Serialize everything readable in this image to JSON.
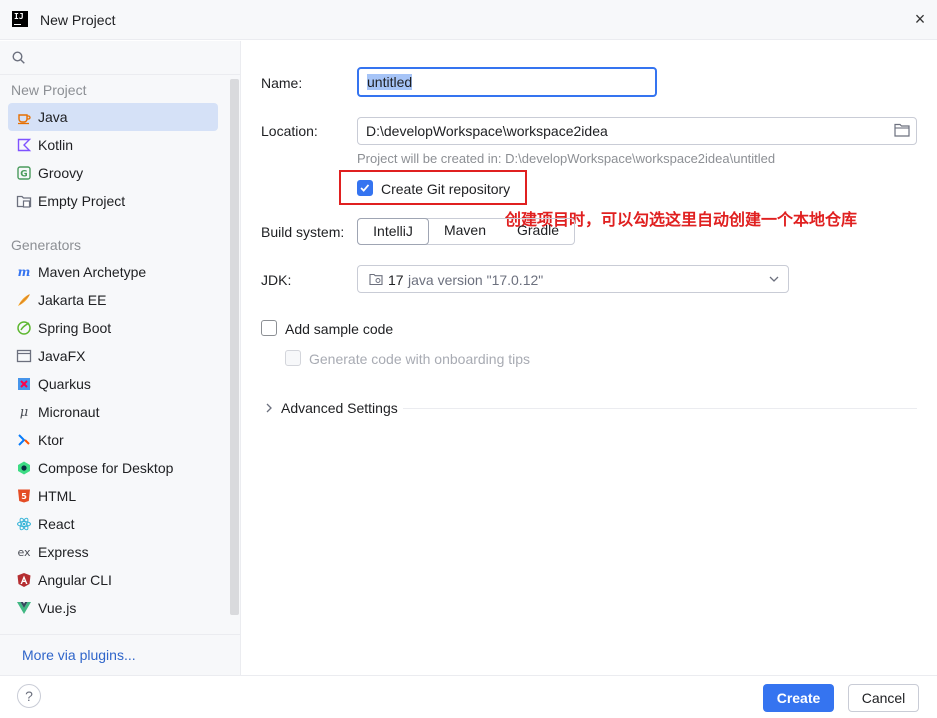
{
  "window": {
    "title": "New Project",
    "close_glyph": "×"
  },
  "sidebar": {
    "search_placeholder": "",
    "group_new_project": "New Project",
    "group_generators": "Generators",
    "new_project_items": [
      {
        "label": "Java",
        "icon": "java-icon",
        "selected": true
      },
      {
        "label": "Kotlin",
        "icon": "kotlin-icon"
      },
      {
        "label": "Groovy",
        "icon": "groovy-icon"
      },
      {
        "label": "Empty Project",
        "icon": "empty-project-icon"
      }
    ],
    "generator_items": [
      {
        "label": "Maven Archetype",
        "icon": "maven-icon"
      },
      {
        "label": "Jakarta EE",
        "icon": "jakarta-icon"
      },
      {
        "label": "Spring Boot",
        "icon": "spring-icon"
      },
      {
        "label": "JavaFX",
        "icon": "javafx-icon"
      },
      {
        "label": "Quarkus",
        "icon": "quarkus-icon"
      },
      {
        "label": "Micronaut",
        "icon": "micronaut-icon"
      },
      {
        "label": "Ktor",
        "icon": "ktor-icon"
      },
      {
        "label": "Compose for Desktop",
        "icon": "compose-icon"
      },
      {
        "label": "HTML",
        "icon": "html-icon"
      },
      {
        "label": "React",
        "icon": "react-icon"
      },
      {
        "label": "Express",
        "icon": "express-icon"
      },
      {
        "label": "Angular CLI",
        "icon": "angular-icon"
      },
      {
        "label": "Vue.js",
        "icon": "vue-icon"
      }
    ],
    "more_plugins": "More via plugins..."
  },
  "form": {
    "name_label": "Name:",
    "name_value": "untitled",
    "location_label": "Location:",
    "location_value": "D:\\developWorkspace\\workspace2idea",
    "location_hint": "Project will be created in: D:\\developWorkspace\\workspace2idea\\untitled",
    "git_label": "Create Git repository",
    "git_checked": true,
    "annotation": "创建项目时，可以勾选这里自动创建一个本地仓库",
    "build_label": "Build system:",
    "build_options": [
      "IntelliJ",
      "Maven",
      "Gradle"
    ],
    "build_selected": "IntelliJ",
    "jdk_label": "JDK:",
    "jdk_version": "17",
    "jdk_desc": "java version \"17.0.12\"",
    "sample_code_label": "Add sample code",
    "onboarding_label": "Generate code with onboarding tips",
    "advanced_label": "Advanced Settings"
  },
  "footer": {
    "help": "?",
    "create": "Create",
    "cancel": "Cancel"
  },
  "colors": {
    "accent": "#3574f0",
    "annotation_red": "#e02020",
    "selection": "#d5e1f7"
  }
}
